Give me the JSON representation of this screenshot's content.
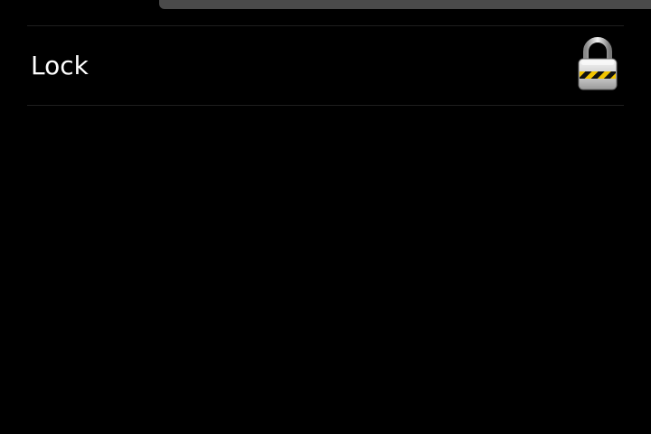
{
  "row": {
    "label": "Lock",
    "icon": "padlock-icon"
  },
  "colors": {
    "background": "#000000",
    "top_bar": "#4a4a4a",
    "divider": "#1e1e1e",
    "text": "#ffffff",
    "lock_stripe_yellow": "#f2c400"
  }
}
